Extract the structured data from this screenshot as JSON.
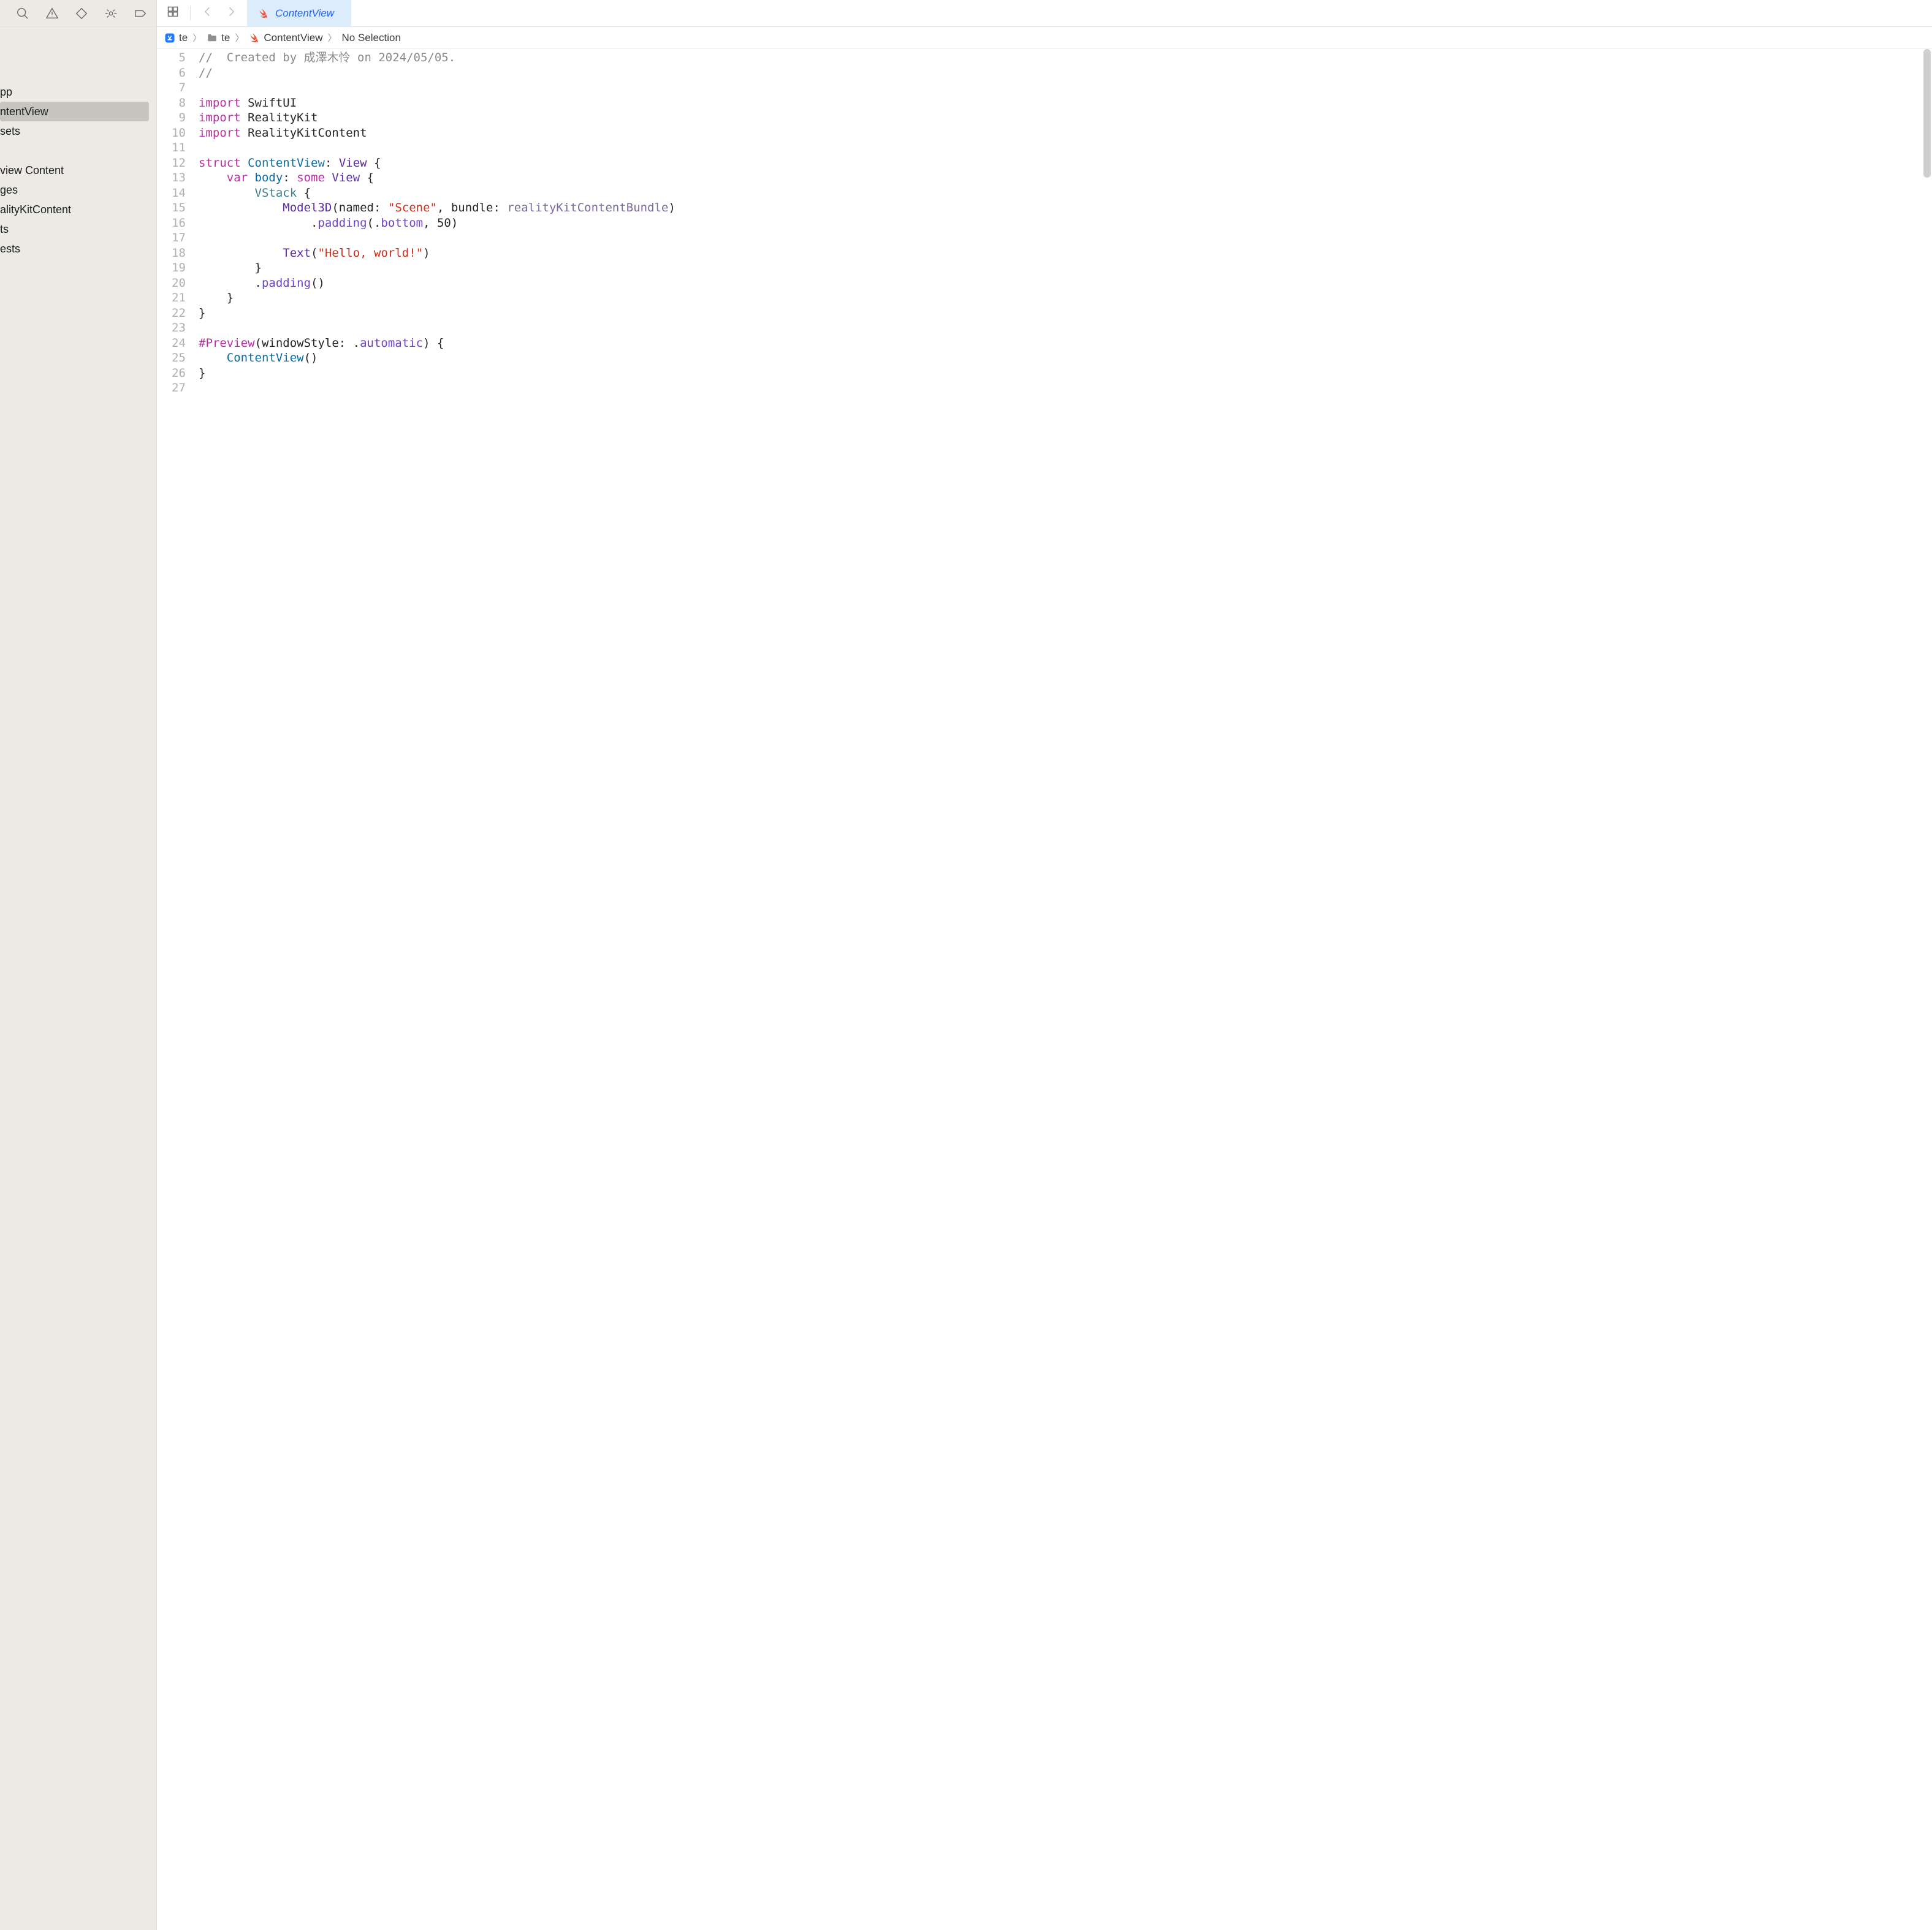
{
  "sidebar": {
    "items": [
      {
        "label": "pp"
      },
      {
        "label": "ntentView",
        "selected": true
      },
      {
        "label": "sets"
      },
      {
        "label": ""
      },
      {
        "label": "view Content"
      },
      {
        "label": "ges"
      },
      {
        "label": "alityKitContent"
      },
      {
        "label": "ts"
      },
      {
        "label": "ests"
      }
    ]
  },
  "tab": {
    "title": "ContentView"
  },
  "breadcrumb": {
    "seg1": "te",
    "seg2": "te",
    "seg3": "ContentView",
    "seg4": "No Selection"
  },
  "code": {
    "first_line_no": 5,
    "lines": [
      {
        "kind": "cmt",
        "text": "//  Created by 成澤木怜 on 2024/05/05."
      },
      {
        "kind": "cmt",
        "text": "//"
      },
      {
        "kind": "blank"
      },
      {
        "kind": "import",
        "module": "SwiftUI"
      },
      {
        "kind": "import",
        "module": "RealityKit"
      },
      {
        "kind": "import",
        "module": "RealityKitContent"
      },
      {
        "kind": "blank"
      },
      {
        "kind": "struct",
        "name": "ContentView",
        "proto": "View"
      },
      {
        "kind": "var",
        "indent": 1,
        "name": "body",
        "some": "some",
        "type": "View"
      },
      {
        "kind": "call0",
        "indent": 2,
        "callee": "VStack",
        "tail": " {"
      },
      {
        "kind": "model3d",
        "indent": 3,
        "callee": "Model3D",
        "p1": "named",
        "s1": "\"Scene\"",
        "p2": "bundle",
        "a2": "realityKitContentBundle"
      },
      {
        "kind": "chain",
        "indent": 4,
        "method": "padding",
        "arg_enum": "bottom",
        "arg_num": "50"
      },
      {
        "kind": "blank"
      },
      {
        "kind": "text",
        "indent": 3,
        "callee": "Text",
        "s": "\"Hello, world!\""
      },
      {
        "kind": "close",
        "indent": 2
      },
      {
        "kind": "chain0",
        "indent": 2,
        "method": "padding"
      },
      {
        "kind": "close",
        "indent": 1
      },
      {
        "kind": "close",
        "indent": 0
      },
      {
        "kind": "blank"
      },
      {
        "kind": "preview",
        "macro": "#Preview",
        "param": "windowStyle",
        "val": "automatic"
      },
      {
        "kind": "callexpr",
        "indent": 1,
        "callee": "ContentView"
      },
      {
        "kind": "close",
        "indent": 0
      },
      {
        "kind": "blank"
      }
    ]
  }
}
